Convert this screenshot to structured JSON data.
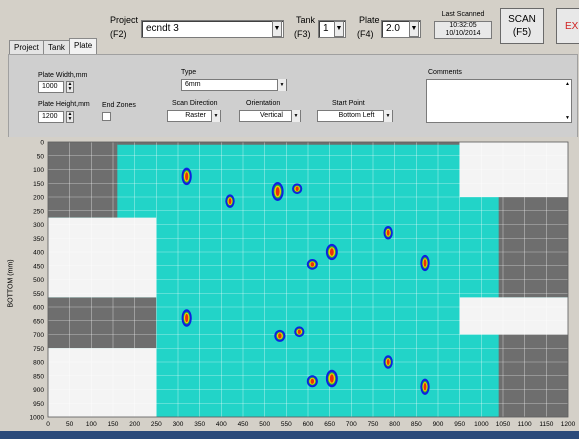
{
  "header": {
    "project_label": "Project",
    "project_key": "(F2)",
    "project_value": "ecndt 3",
    "tank_label": "Tank",
    "tank_key": "(F3)",
    "tank_value": "1",
    "plate_label": "Plate",
    "plate_key": "(F4)",
    "plate_value": "2.0",
    "last_scanned_label": "Last Scanned",
    "last_scanned_time": "10:32:05",
    "last_scanned_date": "10/10/2014",
    "scan_label": "SCAN",
    "scan_key": "(F5)",
    "exit_label": "EX"
  },
  "tabs": [
    {
      "label": "Project"
    },
    {
      "label": "Tank"
    },
    {
      "label": "Plate"
    }
  ],
  "plate_panel": {
    "width_label": "Plate Width,mm",
    "width_value": "1000",
    "height_label": "Plate Height,mm",
    "height_value": "1200",
    "end_zones_label": "End Zones",
    "type_label": "Type",
    "type_value": "6mm",
    "scan_direction_label": "Scan Direction",
    "scan_direction_value": "Raster",
    "orientation_label": "Orientation",
    "orientation_value": "Vertical",
    "start_point_label": "Start Point",
    "start_point_value": "Bottom Left",
    "comments_label": "Comments",
    "comments_value": ""
  },
  "chart_data": {
    "type": "heatmap",
    "ylabel": "BOTTOM (mm)",
    "xlabel": "",
    "xlim": [
      0,
      1200
    ],
    "ylim": [
      0,
      1000
    ],
    "y_inverted": true,
    "x_ticks": [
      0,
      50,
      100,
      150,
      200,
      250,
      300,
      350,
      400,
      450,
      500,
      550,
      600,
      650,
      700,
      750,
      800,
      850,
      900,
      950,
      1000,
      1050,
      1100,
      1150,
      1200
    ],
    "y_ticks": [
      0,
      50,
      100,
      150,
      200,
      250,
      300,
      350,
      400,
      450,
      500,
      550,
      600,
      650,
      700,
      750,
      800,
      850,
      900,
      950,
      1000
    ],
    "grid": true,
    "background_color": "#22d4c8",
    "colors": {
      "scan_area": "#22d4c8",
      "no_data": "#6e6e6e",
      "excluded": "#f4f4f4",
      "hot": "#e83010",
      "warm": "#f0d000",
      "mid": "#20b040",
      "low": "#1020e0"
    },
    "excluded_regions": [
      {
        "x": [
          0,
          250
        ],
        "y": [
          275,
          565
        ]
      },
      {
        "x": [
          0,
          250
        ],
        "y": [
          750,
          1000
        ]
      },
      {
        "x": [
          950,
          1200
        ],
        "y": [
          0,
          200
        ]
      },
      {
        "x": [
          950,
          1200
        ],
        "y": [
          565,
          700
        ]
      }
    ],
    "no_data_regions": [
      {
        "x": [
          0,
          160
        ],
        "y": [
          0,
          275
        ]
      },
      {
        "x": [
          0,
          250
        ],
        "y": [
          565,
          750
        ]
      },
      {
        "x": [
          1040,
          1200
        ],
        "y": [
          200,
          565
        ]
      },
      {
        "x": [
          1040,
          1200
        ],
        "y": [
          700,
          1000
        ]
      },
      {
        "x": [
          160,
          950
        ],
        "y": [
          0,
          10
        ]
      }
    ],
    "indications": [
      {
        "x": 320,
        "y": 125,
        "w": 18,
        "h": 55
      },
      {
        "x": 420,
        "y": 215,
        "w": 16,
        "h": 40
      },
      {
        "x": 530,
        "y": 180,
        "w": 22,
        "h": 60
      },
      {
        "x": 575,
        "y": 170,
        "w": 18,
        "h": 30
      },
      {
        "x": 610,
        "y": 445,
        "w": 20,
        "h": 30
      },
      {
        "x": 655,
        "y": 400,
        "w": 22,
        "h": 50
      },
      {
        "x": 785,
        "y": 330,
        "w": 16,
        "h": 40
      },
      {
        "x": 870,
        "y": 440,
        "w": 16,
        "h": 50
      },
      {
        "x": 320,
        "y": 640,
        "w": 18,
        "h": 55
      },
      {
        "x": 535,
        "y": 705,
        "w": 20,
        "h": 35
      },
      {
        "x": 580,
        "y": 690,
        "w": 18,
        "h": 30
      },
      {
        "x": 610,
        "y": 870,
        "w": 20,
        "h": 35
      },
      {
        "x": 655,
        "y": 860,
        "w": 22,
        "h": 55
      },
      {
        "x": 785,
        "y": 800,
        "w": 16,
        "h": 40
      },
      {
        "x": 870,
        "y": 890,
        "w": 16,
        "h": 50
      }
    ]
  }
}
